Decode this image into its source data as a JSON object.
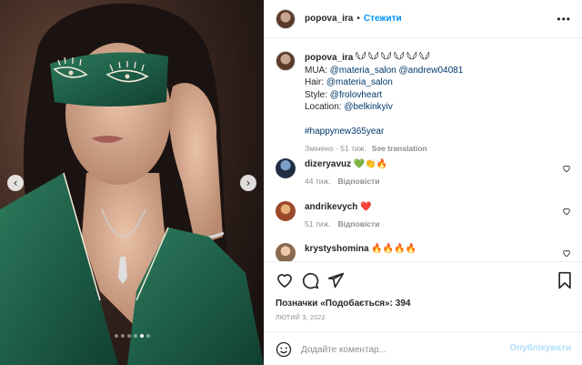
{
  "post": {
    "carousel": {
      "prev_glyph": "‹",
      "next_glyph": "›",
      "total": 6,
      "active_index": 4
    }
  },
  "header": {
    "username": "popova_ira",
    "separator": "•",
    "follow_label": "Стежити",
    "more_glyph": "•••"
  },
  "caption": {
    "username": "popova_ira",
    "lines": [
      "popova_ira 𓆩𓆪 𓆩𓆪 𓆩𓆪 𓆩𓆪 𓆩𓆪 𓆩𓆪",
      "MUA:",
      "@materia_salon @andrew04081",
      "Hair:",
      "@materia_salon",
      "Style:",
      "@frolovheart",
      "Location:",
      "@belkinkyiv",
      "#happynew365year"
    ],
    "edited": "Змінено · 51 тиж.",
    "see_translation": "See translation"
  },
  "comments": [
    {
      "username": "dizeryavuz",
      "text": "💚👏🔥",
      "age": "44 тиж.",
      "reply": "Відповісти"
    },
    {
      "username": "andrikevych",
      "text": "❤️",
      "age": "51 тиж.",
      "reply": "Відповісти"
    },
    {
      "username": "krystyshomina",
      "text": "🔥🔥🔥🔥",
      "age": "",
      "reply": ""
    }
  ],
  "actions": {
    "likes": "Позначки «Подобається»: 394",
    "date": "ЛЮТИЙ 3, 2022"
  },
  "add_comment": {
    "placeholder": "Додайте коментар...",
    "publish_label": "Опублікувати"
  },
  "colors": {
    "accent": "#0095f6",
    "link": "#00376b",
    "muted": "#8e8e8e",
    "silk_green": "#1e5e48",
    "publish_disabled": "#b2dffc"
  }
}
